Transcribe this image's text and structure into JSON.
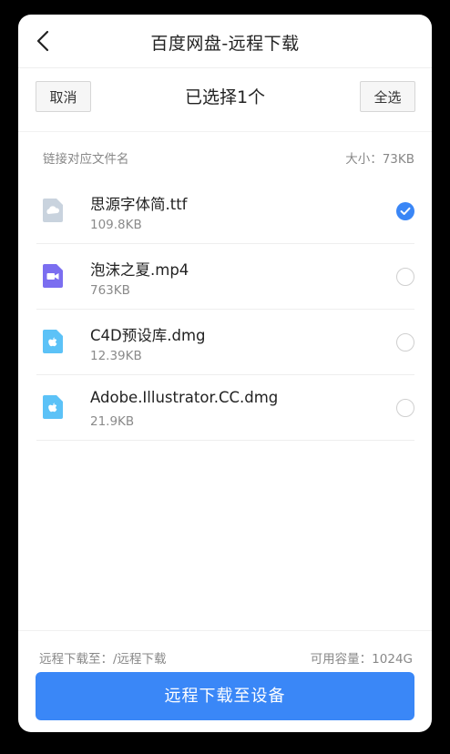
{
  "nav": {
    "title": "百度网盘-远程下载",
    "back_icon": "chevron-left-icon"
  },
  "toolbar": {
    "cancel_label": "取消",
    "selection_title": "已选择1个",
    "select_all_label": "全选"
  },
  "list_header": {
    "left": "链接对应文件名",
    "right": "大小：73KB"
  },
  "files": [
    {
      "name": "思源字体简.ttf",
      "size": "109.8KB",
      "icon": "font-file-icon",
      "selected": true
    },
    {
      "name": "泡沫之夏.mp4",
      "size": "763KB",
      "icon": "video-file-icon",
      "selected": false
    },
    {
      "name": "C4D预设库.dmg",
      "size": "12.39KB",
      "icon": "dmg-file-icon",
      "selected": false
    },
    {
      "name": "Adobe.Illustrator.CC.dmg",
      "size": "21.9KB",
      "icon": "dmg-file-icon",
      "selected": false
    }
  ],
  "footer": {
    "path": "远程下载至：/远程下载",
    "capacity": "可用容量：1024G",
    "button_label": "远程下载至设备"
  },
  "colors": {
    "accent": "#3a87f7",
    "video_icon": "#7b6ef0",
    "dmg_icon": "#5cc2f7",
    "font_icon": "#c9d3de"
  }
}
